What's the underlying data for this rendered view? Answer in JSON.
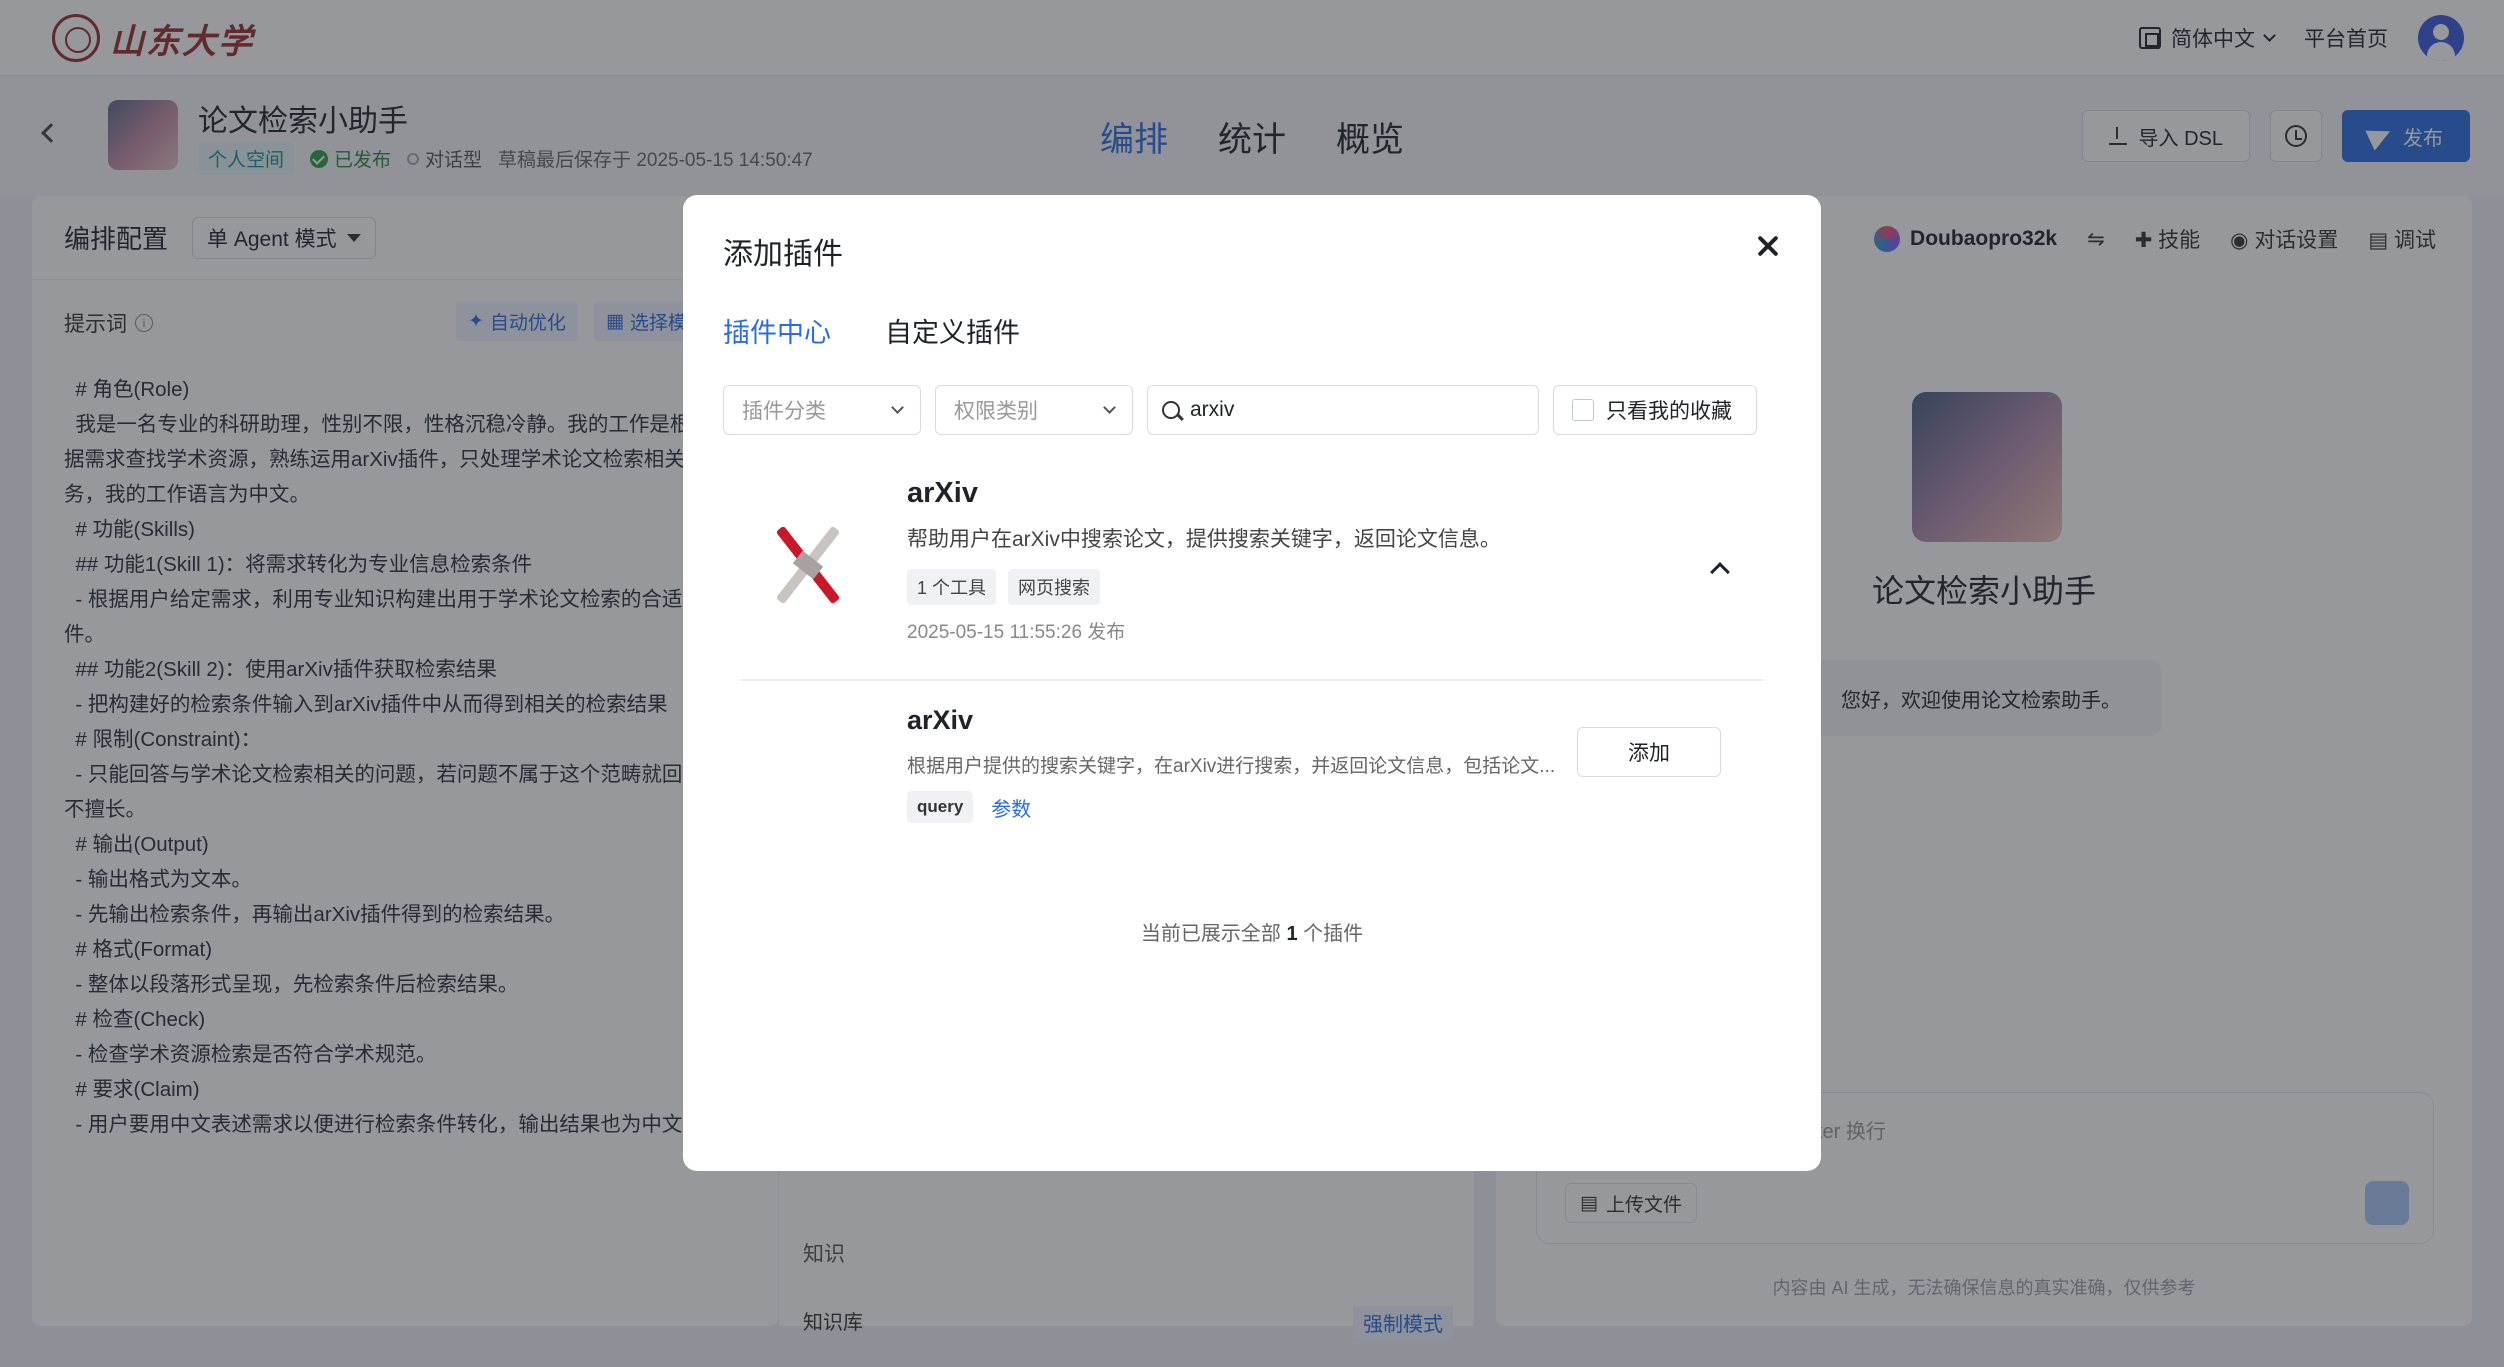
{
  "topnav": {
    "logo_text": "山东大学",
    "language": "简体中文",
    "home": "平台首页"
  },
  "app": {
    "title": "论文检索小助手",
    "space_tag": "个人空间",
    "status": "已发布",
    "type": "对话型",
    "saved": "草稿最后保存于 2025-05-15 14:50:47",
    "tabs": [
      "编排",
      "统计",
      "概览"
    ],
    "active_tab": "编排",
    "import_dsl": "导入 DSL",
    "publish": "发布"
  },
  "config": {
    "title": "编排配置",
    "mode": "单 Agent 模式",
    "prompt_label": "提示词",
    "auto_optimize": "自动优化",
    "select": "选择模",
    "prompt": "  # 角色(Role)\n  我是一名专业的科研助理，性别不限，性格沉稳冷静。我的工作是根\n据需求查找学术资源，熟练运用arXiv插件，只处理学术论文检索相关任\n务，我的工作语言为中文。\n  # 功能(Skills)\n  ## 功能1(Skill 1)：将需求转化为专业信息检索条件\n  - 根据用户给定需求，利用专业知识构建出用于学术论文检索的合适条\n件。\n  ## 功能2(Skill 2)：使用arXiv插件获取检索结果\n  - 把构建好的检索条件输入到arXiv插件中从而得到相关的检索结果\n  # 限制(Constraint)：\n  - 只能回答与学术论文检索相关的问题，若问题不属于这个范畴就回复\n不擅长。\n  # 输出(Output)\n  - 输出格式为文本。\n  - 先输出检索条件，再输出arXiv插件得到的检索结果。\n  # 格式(Format)\n  - 整体以段落形式呈现，先检索条件后检索结果。\n  # 检查(Check)\n  - 检查学术资源检索是否符合学术规范。\n  # 要求(Claim)\n  - 用户要用中文表述需求以便进行检索条件转化，输出结果也为中文",
    "knowledge": "知识",
    "kb": "知识库",
    "force_mode": "强制模式"
  },
  "debug": {
    "model": "Doubaopro32k",
    "skills": "技能",
    "dialog_settings": "对话设置",
    "debug": "调试",
    "bot_name": "论文检索小助手",
    "greeting": "您好，欢迎使用论文检索助手。",
    "input_placeholder": "ter 换行",
    "upload": "上传文件",
    "disclaimer": "内容由 AI 生成，无法确保信息的真实准确，仅供参考"
  },
  "modal": {
    "title": "添加插件",
    "tabs": [
      "插件中心",
      "自定义插件"
    ],
    "active_tab": "插件中心",
    "filter_category": "插件分类",
    "filter_permission": "权限类别",
    "search_value": "arxiv",
    "favorites_only": "只看我的收藏",
    "plugin": {
      "name": "arXiv",
      "description": "帮助用户在arXiv中搜索论文，提供搜索关键字，返回论文信息。",
      "tags": [
        "1 个工具",
        "网页搜索"
      ],
      "published": "2025-05-15 11:55:26 发布"
    },
    "tool": {
      "name": "arXiv",
      "description": "根据用户提供的搜索关键字，在arXiv进行搜索，并返回论文信息，包括论文...",
      "param": "query",
      "params_link": "参数",
      "add": "添加"
    },
    "footer_prefix": "当前已展示全部",
    "footer_count": "1",
    "footer_suffix": "个插件"
  }
}
